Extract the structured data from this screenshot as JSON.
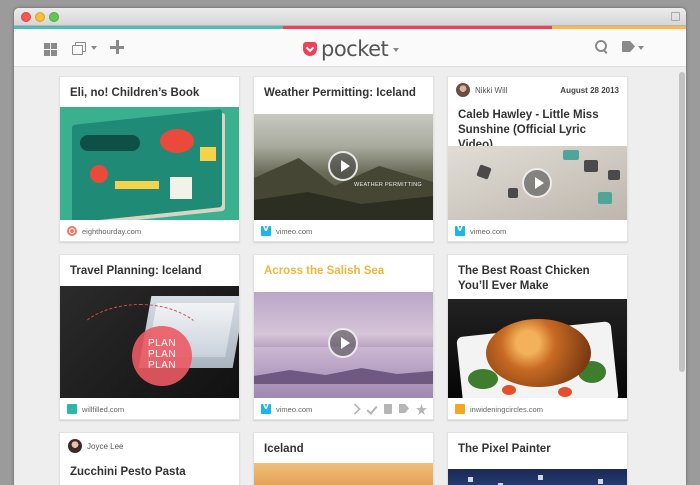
{
  "app": {
    "name": "pocket"
  },
  "colors": {
    "bar": [
      "#50bcb6",
      "#50bcb6",
      "#ee4056",
      "#ee4056",
      "#fcb64c"
    ],
    "accent": "#ee4056"
  },
  "toolbar": {
    "grid_icon": "grid-view-icon",
    "list_icon": "list-view-icon",
    "add_icon": "add-icon",
    "search_icon": "search-icon",
    "tag_icon": "tag-icon"
  },
  "cards": [
    {
      "title": "Eli, no! Children’s Book",
      "source": "eighthourday.com",
      "source_icon": "eighthourday-icon"
    },
    {
      "title": "Weather Permitting: Iceland",
      "source": "vimeo.com",
      "source_icon": "vimeo-icon",
      "video": true,
      "thumb_caption": "WEATHER PERMITTING"
    },
    {
      "author": "Nikki Will",
      "date": "August 28 2013",
      "title": "Caleb Hawley - Little Miss Sunshine (Official Lyric Video)",
      "source": "vimeo.com",
      "source_icon": "vimeo-icon",
      "video": true
    },
    {
      "title": "Travel Planning: Iceland",
      "source": "willfilled.com",
      "source_icon": "willfilled-icon",
      "thumb_text": [
        "PLAN",
        "PLAN",
        "PLAN"
      ]
    },
    {
      "title": "Across the Salish Sea",
      "source": "vimeo.com",
      "source_icon": "vimeo-icon",
      "video": true,
      "hovered": true
    },
    {
      "title": "The Best Roast Chicken You’ll Ever Make",
      "source": "inwideningcircles.com",
      "source_icon": "inwideningcircles-icon"
    },
    {
      "author": "Joyce Lee",
      "title": "Zucchini Pesto Pasta"
    },
    {
      "title": "Iceland"
    },
    {
      "title": "The Pixel Painter"
    }
  ]
}
